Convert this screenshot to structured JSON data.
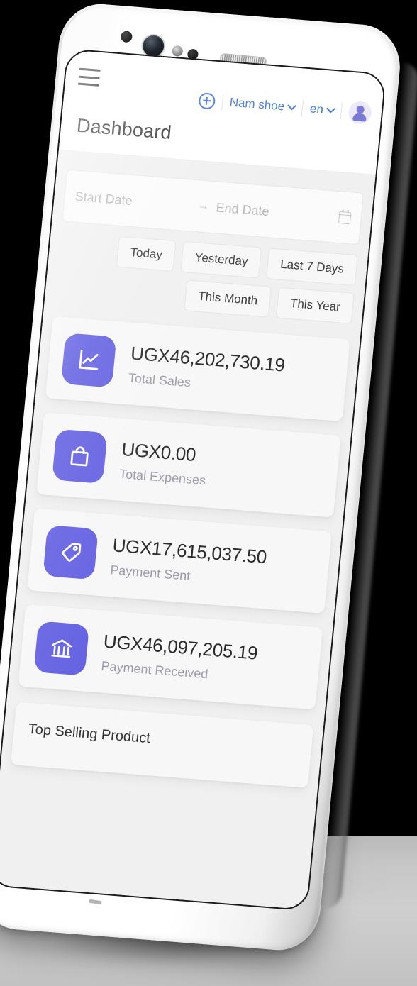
{
  "topbar": {
    "menu_icon": "hamburger-menu-icon",
    "add_icon": "plus-circle-icon",
    "store_name": "Nam shoe",
    "language": "en",
    "avatar_icon": "user-avatar-icon"
  },
  "page": {
    "title": "Dashboard"
  },
  "date_range": {
    "start_placeholder": "Start Date",
    "arrow": "→",
    "end_placeholder": "End Date",
    "calendar_icon": "calendar-icon",
    "quick_filters": [
      "Today",
      "Yesterday",
      "Last 7 Days",
      "This Month",
      "This Year"
    ]
  },
  "stats": [
    {
      "value": "UGX46,202,730.19",
      "label": "Total Sales",
      "icon": "line-chart-icon"
    },
    {
      "value": "UGX0.00",
      "label": "Total Expenses",
      "icon": "shopping-bag-icon"
    },
    {
      "value": "UGX17,615,037.50",
      "label": "Payment Sent",
      "icon": "price-tag-icon"
    },
    {
      "value": "UGX46,097,205.19",
      "label": "Payment Received",
      "icon": "bank-icon"
    }
  ],
  "top_selling": {
    "title": "Top Selling Product"
  },
  "colors": {
    "accent_purple": "#6562e2",
    "link_blue": "#4479d4",
    "page_bg": "#f0f0f0",
    "card_bg": "#f7f7f7",
    "value_text": "#2b2b2b",
    "label_text": "#9b9bab"
  }
}
